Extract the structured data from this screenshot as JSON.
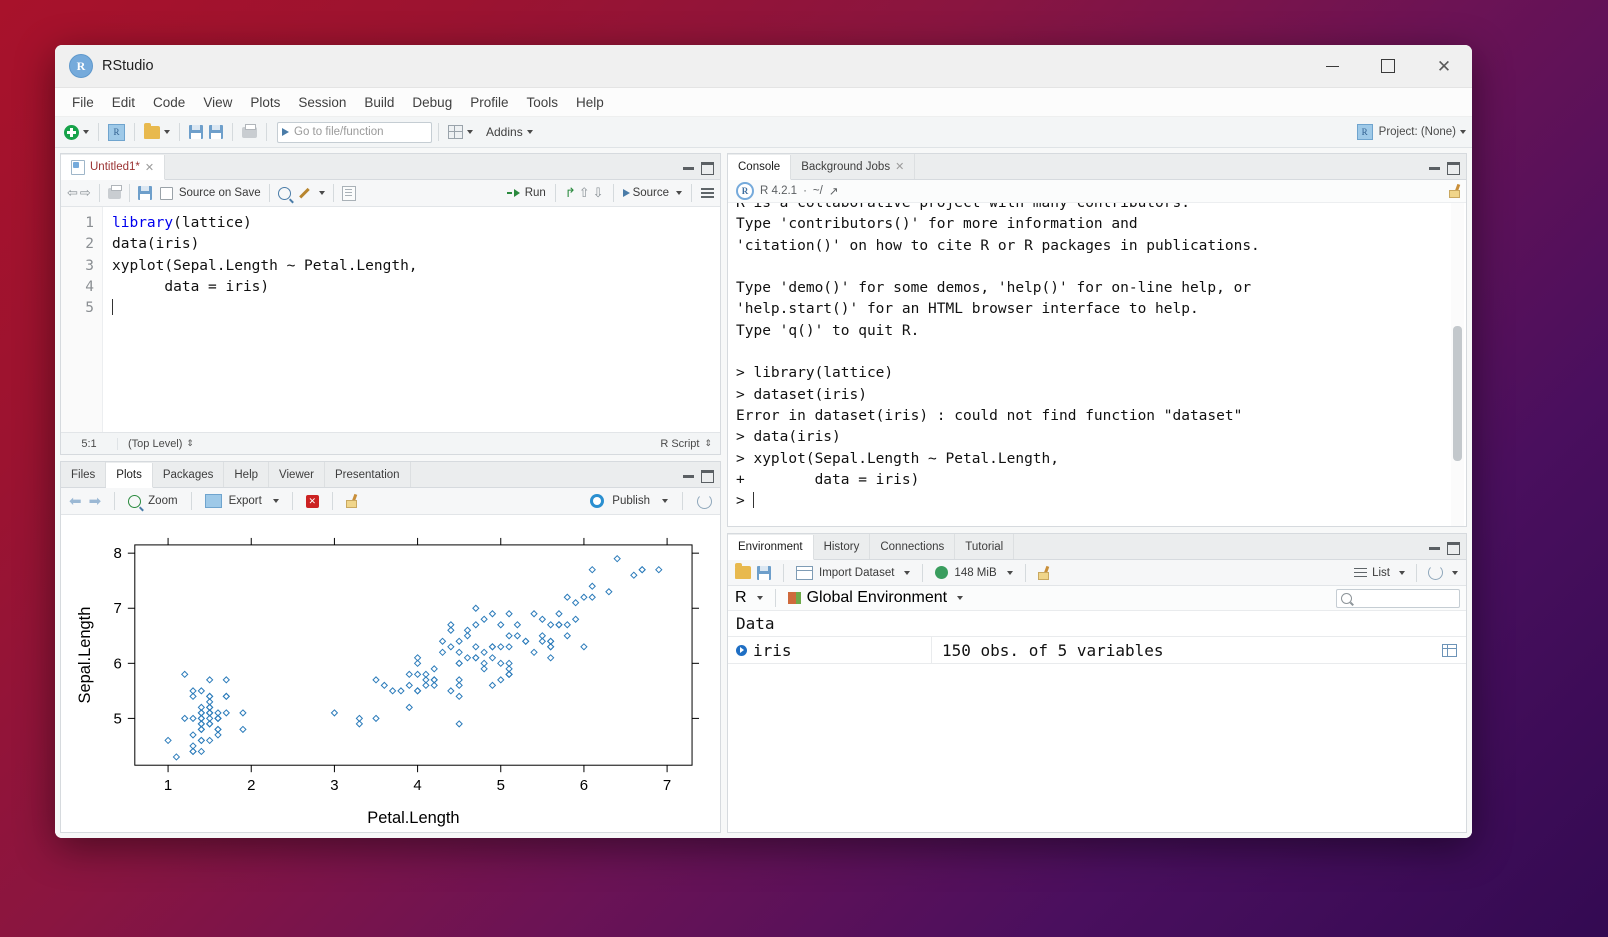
{
  "window": {
    "title": "RStudio",
    "app_icon": "R",
    "controls": {
      "minimize": "minimize-icon",
      "maximize": "maximize-icon",
      "close": "✕"
    }
  },
  "menubar": {
    "items": [
      "File",
      "Edit",
      "Code",
      "View",
      "Plots",
      "Session",
      "Build",
      "Debug",
      "Profile",
      "Tools",
      "Help"
    ]
  },
  "toolbar": {
    "goto_placeholder": "Go to file/function",
    "addins_label": "Addins",
    "project_label": "Project: (None)"
  },
  "editor": {
    "tab_label": "Untitled1*",
    "toolbar": {
      "source_on_save": "Source on Save",
      "run_label": "Run",
      "source_label": "Source"
    },
    "lines": [
      {
        "n": "1",
        "text": "library(lattice)",
        "kw": "library",
        "rest": "(lattice)"
      },
      {
        "n": "2",
        "text": "data(iris)",
        "kw": "",
        "rest": "data(iris)"
      },
      {
        "n": "3",
        "text": "xyplot(Sepal.Length ~ Petal.Length,",
        "kw": "",
        "rest": "xyplot(Sepal.Length ~ Petal.Length,"
      },
      {
        "n": "4",
        "text": "      data = iris)",
        "kw": "",
        "rest": "      data = iris)"
      },
      {
        "n": "5",
        "text": "",
        "kw": "",
        "rest": ""
      }
    ],
    "status": {
      "position": "5:1",
      "scope": "(Top Level)",
      "filetype": "R Script"
    }
  },
  "plots_pane": {
    "tabs": [
      "Files",
      "Plots",
      "Packages",
      "Help",
      "Viewer",
      "Presentation"
    ],
    "active_tab": "Plots",
    "toolbar": {
      "zoom_label": "Zoom",
      "export_label": "Export",
      "publish_label": "Publish"
    }
  },
  "chart_data": {
    "type": "scatter",
    "title": "",
    "xlabel": "Petal.Length",
    "ylabel": "Sepal.Length",
    "xlim": [
      0.6,
      7.3
    ],
    "ylim": [
      4.15,
      8.15
    ],
    "xticks": [
      1,
      2,
      3,
      4,
      5,
      6,
      7
    ],
    "yticks": [
      5,
      6,
      7,
      8
    ],
    "grid": false,
    "point_color": "#2b7bba",
    "point_symbol": "open-diamond",
    "dataset": "iris",
    "n_points": 150,
    "x": [
      1.4,
      1.4,
      1.3,
      1.5,
      1.4,
      1.7,
      1.4,
      1.5,
      1.4,
      1.5,
      1.5,
      1.6,
      1.4,
      1.1,
      1.2,
      1.5,
      1.3,
      1.4,
      1.7,
      1.5,
      1.7,
      1.5,
      1.0,
      1.7,
      1.9,
      1.6,
      1.6,
      1.5,
      1.4,
      1.6,
      1.6,
      1.5,
      1.5,
      1.4,
      1.5,
      1.2,
      1.3,
      1.4,
      1.3,
      1.5,
      1.3,
      1.3,
      1.3,
      1.6,
      1.9,
      1.4,
      1.6,
      1.4,
      1.5,
      1.4,
      4.7,
      4.5,
      4.9,
      4.0,
      4.6,
      4.5,
      4.7,
      3.3,
      4.6,
      3.9,
      3.5,
      4.2,
      4.0,
      4.7,
      3.6,
      4.4,
      4.5,
      4.1,
      4.5,
      3.9,
      4.8,
      4.0,
      4.9,
      4.7,
      4.3,
      4.4,
      4.8,
      5.0,
      4.5,
      3.5,
      3.8,
      3.7,
      3.9,
      5.1,
      4.5,
      4.5,
      4.7,
      4.4,
      4.1,
      4.0,
      4.4,
      4.6,
      4.0,
      3.3,
      4.2,
      4.2,
      4.2,
      4.3,
      3.0,
      4.1,
      6.0,
      5.1,
      5.9,
      5.6,
      5.8,
      6.6,
      4.5,
      6.3,
      5.8,
      6.1,
      5.1,
      5.3,
      5.5,
      5.0,
      5.1,
      5.3,
      5.5,
      6.7,
      6.9,
      5.0,
      5.7,
      4.9,
      6.7,
      4.9,
      5.7,
      6.0,
      4.8,
      4.9,
      5.6,
      5.8,
      6.1,
      6.4,
      5.6,
      5.1,
      5.6,
      6.1,
      5.6,
      5.5,
      4.8,
      5.4,
      5.6,
      5.1,
      5.1,
      5.9,
      5.7,
      5.2,
      5.0,
      5.2,
      5.4,
      5.1
    ],
    "y": [
      5.1,
      4.9,
      4.7,
      4.6,
      5.0,
      5.4,
      4.6,
      5.0,
      4.4,
      4.9,
      5.4,
      4.8,
      4.8,
      4.3,
      5.8,
      5.7,
      5.4,
      5.1,
      5.7,
      5.1,
      5.4,
      5.1,
      4.6,
      5.1,
      4.8,
      5.0,
      5.0,
      5.2,
      5.2,
      4.7,
      4.8,
      5.4,
      5.2,
      5.5,
      4.9,
      5.0,
      5.5,
      4.9,
      4.4,
      5.1,
      5.0,
      4.5,
      4.4,
      5.0,
      5.1,
      4.8,
      5.1,
      4.6,
      5.3,
      5.0,
      7.0,
      6.4,
      6.9,
      5.5,
      6.5,
      5.7,
      6.3,
      4.9,
      6.6,
      5.2,
      5.0,
      5.9,
      6.0,
      6.1,
      5.6,
      6.7,
      5.6,
      5.8,
      6.2,
      5.6,
      5.9,
      6.1,
      6.3,
      6.1,
      6.4,
      6.6,
      6.8,
      6.7,
      6.0,
      5.7,
      5.5,
      5.5,
      5.8,
      6.0,
      5.4,
      6.0,
      6.7,
      6.3,
      5.6,
      5.5,
      5.5,
      6.1,
      5.8,
      5.0,
      5.6,
      5.7,
      5.7,
      6.2,
      5.1,
      5.7,
      6.3,
      5.8,
      7.1,
      6.3,
      6.5,
      7.6,
      4.9,
      7.3,
      6.7,
      7.2,
      6.5,
      6.4,
      6.8,
      5.7,
      5.8,
      6.4,
      6.5,
      7.7,
      7.7,
      6.0,
      6.9,
      5.6,
      7.7,
      6.3,
      6.7,
      7.2,
      6.2,
      6.1,
      6.4,
      7.2,
      7.4,
      7.9,
      6.4,
      6.3,
      6.1,
      7.7,
      6.3,
      6.4,
      6.0,
      6.9,
      6.7,
      6.9,
      5.8,
      6.8,
      6.7,
      6.7,
      6.3,
      6.5,
      6.2,
      5.9
    ]
  },
  "console": {
    "tabs": [
      "Console",
      "Background Jobs"
    ],
    "active_tab": "Console",
    "r_version": "R 4.2.1",
    "working_dir": "~/",
    "lines": [
      {
        "text": "R is a collaborative project with many contributors.",
        "color": "black",
        "clipped": true
      },
      {
        "text": "Type 'contributors()' for more information and",
        "color": "black"
      },
      {
        "text": "'citation()' on how to cite R or R packages in publications.",
        "color": "black"
      },
      {
        "text": "",
        "color": "black"
      },
      {
        "text": "Type 'demo()' for some demos, 'help()' for on-line help, or",
        "color": "black"
      },
      {
        "text": "'help.start()' for an HTML browser interface to help.",
        "color": "black"
      },
      {
        "text": "Type 'q()' to quit R.",
        "color": "black"
      },
      {
        "text": "",
        "color": "black"
      },
      {
        "text": "> library(lattice)",
        "color": "blue"
      },
      {
        "text": "> dataset(iris)",
        "color": "blue"
      },
      {
        "text": "Error in dataset(iris) : could not find function \"dataset\"",
        "color": "red"
      },
      {
        "text": "> data(iris)",
        "color": "blue"
      },
      {
        "text": "> xyplot(Sepal.Length ~ Petal.Length,",
        "color": "blue"
      },
      {
        "text": "+        data = iris)",
        "color": "blue"
      },
      {
        "text": "> ",
        "color": "blue",
        "cursor": true
      }
    ]
  },
  "environment": {
    "tabs": [
      "Environment",
      "History",
      "Connections",
      "Tutorial"
    ],
    "active_tab": "Environment",
    "toolbar": {
      "import_label": "Import Dataset",
      "memory_label": "148 MiB",
      "view_mode": "List"
    },
    "scope": {
      "language": "R",
      "env_label": "Global Environment"
    },
    "group_header": "Data",
    "rows": [
      {
        "name": "iris",
        "value": "150 obs. of 5 variables"
      }
    ]
  }
}
